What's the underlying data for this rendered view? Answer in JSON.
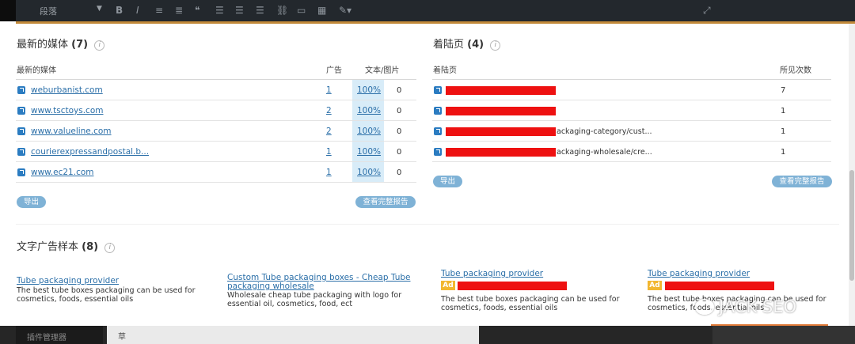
{
  "toolbar": {
    "format_label": "段落",
    "icons": [
      "dropdown-arrow-icon",
      "bold-icon",
      "italic-icon",
      "bullet-list-icon",
      "numbered-list-icon",
      "blockquote-icon",
      "align-left-icon",
      "align-center-icon",
      "align-right-icon",
      "link-icon",
      "unlink-icon",
      "keyboard-icon",
      "color-picker-icon",
      "expand-icon"
    ]
  },
  "media": {
    "title": "最新的媒体",
    "count": "(7)",
    "columns": {
      "media": "最新的媒体",
      "ads": "广告",
      "text_image": "文本/图片"
    },
    "rows": [
      {
        "site": "weburbanist.com",
        "ads": "1",
        "pct": "100%",
        "img": "0"
      },
      {
        "site": "www.tsctoys.com",
        "ads": "2",
        "pct": "100%",
        "img": "0"
      },
      {
        "site": "www.valueline.com",
        "ads": "2",
        "pct": "100%",
        "img": "0"
      },
      {
        "site": "courierexpressandpostal.b...",
        "ads": "1",
        "pct": "100%",
        "img": "0"
      },
      {
        "site": "www.ec21.com",
        "ads": "1",
        "pct": "100%",
        "img": "0"
      }
    ],
    "export_label": "导出",
    "full_report_label": "查看完整报告"
  },
  "landing": {
    "title": "着陆页",
    "count": "(4)",
    "columns": {
      "page": "着陆页",
      "seen": "所见次数"
    },
    "rows": [
      {
        "tail": "",
        "seen": "7"
      },
      {
        "tail": "",
        "seen": "1"
      },
      {
        "tail": "ackaging-category/cust...",
        "seen": "1"
      },
      {
        "tail": "ackaging-wholesale/cre...",
        "seen": "1"
      }
    ],
    "export_label": "导出",
    "full_report_label": "查看完整报告"
  },
  "text_ads": {
    "title": "文字广告样本",
    "count": "(8)",
    "ads": [
      {
        "title": "Tube packaging provider",
        "desc": "The best tube boxes packaging can be used for cosmetics, foods, essential oils"
      },
      {
        "title": "Custom Tube packaging boxes - Cheap Tube packaging wholesale",
        "desc": "Wholesale cheap tube packaging with logo for essential oil, cosmetics, food, ect"
      },
      {
        "title": "Tube packaging provider",
        "badge": "Ad",
        "desc": "The best tube boxes packaging can be used for cosmetics, foods, essential oils"
      },
      {
        "title": "Tube packaging provider",
        "badge": "Ad",
        "desc": "The best tube boxes packaging can be used for cosmetics, foods, essential oils"
      }
    ]
  },
  "bottom_bar": {
    "left_label": "插件管理器",
    "middle_label": "草"
  },
  "watermark": {
    "text": "JACK SEO"
  },
  "colors": {
    "accent_orange": "#c38a3a",
    "link_blue": "#2b6fa8",
    "pill_blue": "#7fb2d6",
    "redaction_red": "#ee1111",
    "ad_badge": "#f2b731"
  }
}
